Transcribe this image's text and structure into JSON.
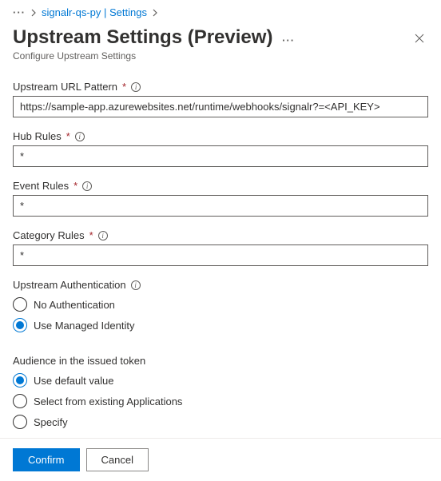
{
  "breadcrumb": {
    "link": "signalr-qs-py | Settings"
  },
  "header": {
    "title": "Upstream Settings (Preview)",
    "subtitle": "Configure Upstream Settings"
  },
  "fields": {
    "url": {
      "label": "Upstream URL Pattern",
      "value": "https://sample-app.azurewebsites.net/runtime/webhooks/signalr?=<API_KEY>"
    },
    "hub": {
      "label": "Hub Rules",
      "value": "*"
    },
    "event": {
      "label": "Event Rules",
      "value": "*"
    },
    "category": {
      "label": "Category Rules",
      "value": "*"
    }
  },
  "auth": {
    "label": "Upstream Authentication",
    "options": {
      "none": "No Authentication",
      "managed": "Use Managed Identity"
    }
  },
  "audience": {
    "label": "Audience in the issued token",
    "options": {
      "default": "Use default value",
      "existing": "Select from existing Applications",
      "specify": "Specify"
    }
  },
  "footer": {
    "confirm": "Confirm",
    "cancel": "Cancel"
  }
}
